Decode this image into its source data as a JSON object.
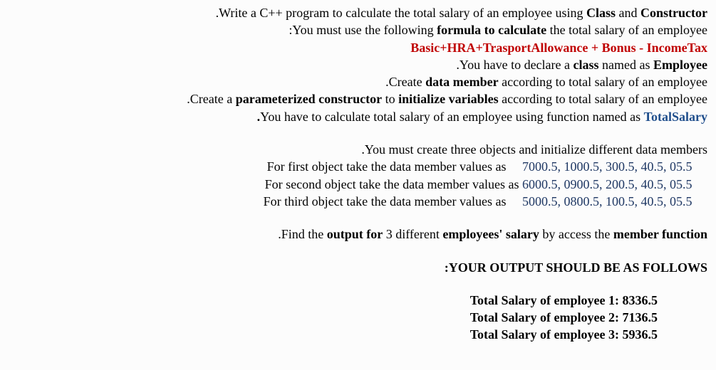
{
  "line1": {
    "t1": ".Write a C++ program to calculate the total salary of an employee using ",
    "b1": "Class",
    "t2": " and ",
    "b2": "Constructor"
  },
  "line2": {
    "t1": ":You must use the following ",
    "b1": "formula to calculate",
    "t2": " the total salary of an employee"
  },
  "formula": "Basic+HRA+TrasportAllowance + Bonus - IncomeTax",
  "line4": {
    "t1": ".You have to declare a ",
    "b1": "class",
    "t2": " named as ",
    "b2": "Employee"
  },
  "line5": {
    "t1": ".Create ",
    "b1": "data member",
    "t2": " according to total salary of an employee"
  },
  "line6": {
    "t1": ".Create a ",
    "b1": "parameterized constructor",
    "t2": " to ",
    "b2": "initialize variables",
    "t3": " according to total salary of an employee"
  },
  "line7": {
    "b1": ".",
    "t1": "You have to calculate total salary of an employee using function named as ",
    "b2": "TotalSalary"
  },
  "line8": ".You must create three objects and initialize different data members",
  "obj1": {
    "label": "For first object take the data member values as",
    "values": "7000.5, 1000.5,  300.5, 40.5, 05.5"
  },
  "obj2": {
    "label": "For second object take the data member values as",
    "values": "6000.5,  0900.5,  200.5, 40.5, 05.5"
  },
  "obj3": {
    "label": "For third object take the data member values as",
    "values": "5000.5,  0800.5, 100.5,  40.5, 05.5"
  },
  "line12": {
    "t1": ".Find the ",
    "b1": "output for",
    "t2": " 3 different ",
    "b2": "employees' salary",
    "t3": " by access the ",
    "b3": "member function"
  },
  "outputHeader": ":YOUR OUTPUT SHOULD BE AS FOLLOWS",
  "out1": "Total Salary of employee 1: 8336.5",
  "out2": "Total Salary of employee 2: 7136.5",
  "out3": "Total Salary of employee 3: 5936.5"
}
